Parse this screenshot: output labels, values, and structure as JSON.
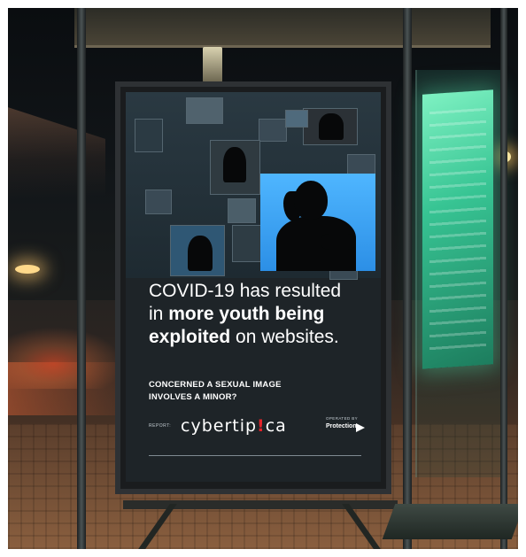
{
  "poster": {
    "headline_line1": "COVID-19 has resulted",
    "headline_line2_prefix": "in ",
    "headline_line2_bold": "more youth being",
    "headline_line3_bold": "exploited",
    "headline_line3_rest": " on websites.",
    "question_line1": "CONCERNED A SEXUAL IMAGE",
    "question_line2": "INVOLVES A MINOR?",
    "report_label": "REPORT:",
    "logo_part1": "cybertip",
    "logo_bang": "!",
    "logo_part2": "ca",
    "sponsor_label": "OPERATED BY",
    "sponsor_name": "Protection"
  },
  "colors": {
    "accent_blue": "#4fb6ff",
    "logo_bang_red": "#e2232a",
    "sign_green": "#37c493"
  }
}
